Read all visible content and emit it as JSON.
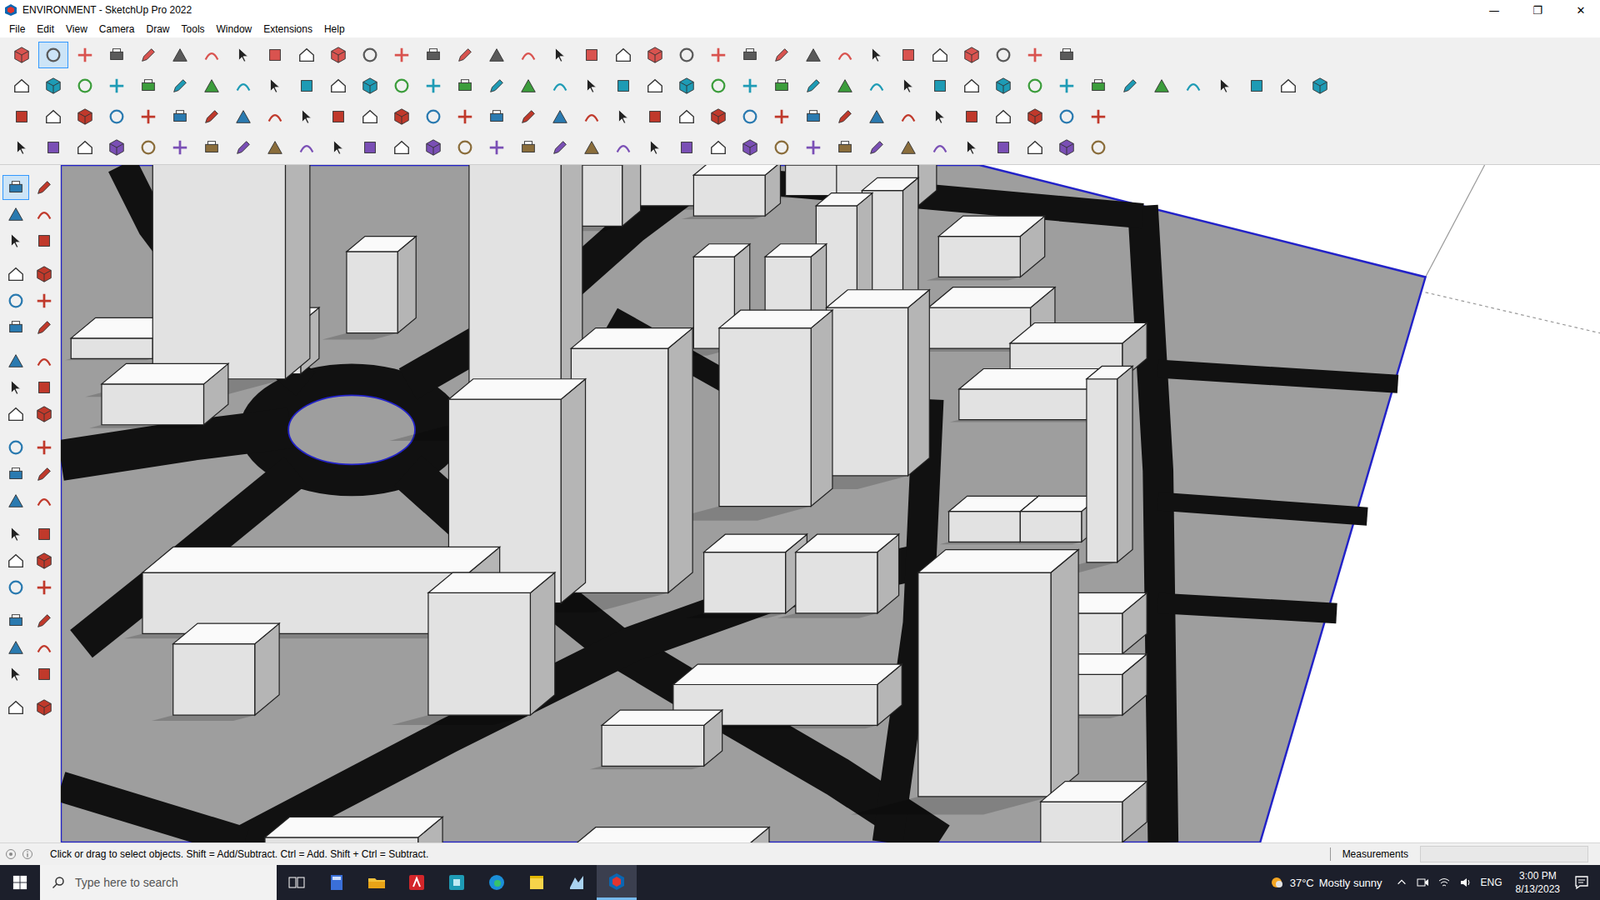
{
  "window": {
    "title": "ENVIRONMENT - SketchUp Pro 2022",
    "controls": [
      "—",
      "❐",
      "✕"
    ]
  },
  "menu": [
    "File",
    "Edit",
    "View",
    "Camera",
    "Draw",
    "Tools",
    "Window",
    "Extensions",
    "Help"
  ],
  "toolbars": [
    {
      "buttons": [
        {
          "selected": false
        },
        {
          "selected": true
        },
        {
          "selected": false
        },
        {
          "selected": false
        },
        {
          "selected": false
        },
        {
          "selected": false
        },
        {
          "selected": false
        },
        {
          "selected": false
        },
        {
          "selected": false
        },
        {
          "selected": false
        },
        {
          "selected": false
        },
        {
          "selected": false
        },
        {
          "selected": false
        },
        {
          "selected": false
        },
        {
          "selected": false
        },
        {
          "selected": false
        },
        {
          "selected": false
        },
        {
          "selected": false
        },
        {
          "selected": false
        },
        {
          "selected": false
        },
        {
          "selected": false
        },
        {
          "selected": false
        },
        {
          "selected": false
        },
        {
          "selected": false
        },
        {
          "selected": false
        },
        {
          "selected": false
        },
        {
          "selected": false
        },
        {
          "selected": false
        },
        {
          "selected": false
        },
        {
          "selected": false
        },
        {
          "selected": false
        },
        {
          "selected": false
        },
        {
          "selected": false
        },
        {
          "selected": false
        }
      ]
    },
    {
      "buttons": [
        {
          "selected": false
        },
        {
          "selected": false
        },
        {
          "selected": false
        },
        {
          "selected": false
        },
        {
          "selected": false
        },
        {
          "selected": false
        },
        {
          "selected": false
        },
        {
          "selected": false
        },
        {
          "selected": false
        },
        {
          "selected": false
        },
        {
          "selected": false
        },
        {
          "selected": false
        },
        {
          "selected": false
        },
        {
          "selected": false
        },
        {
          "selected": false
        },
        {
          "selected": false
        },
        {
          "selected": false
        },
        {
          "selected": false
        },
        {
          "selected": false
        },
        {
          "selected": false
        },
        {
          "selected": false
        },
        {
          "selected": false
        },
        {
          "selected": false
        },
        {
          "selected": false
        },
        {
          "selected": false
        },
        {
          "selected": false
        },
        {
          "selected": false
        },
        {
          "selected": false
        },
        {
          "selected": false
        },
        {
          "selected": false
        },
        {
          "selected": false
        },
        {
          "selected": false
        },
        {
          "selected": false
        },
        {
          "selected": false
        },
        {
          "selected": false
        },
        {
          "selected": false
        },
        {
          "selected": false
        },
        {
          "selected": false
        },
        {
          "selected": false
        },
        {
          "selected": false
        },
        {
          "selected": false
        },
        {
          "selected": false
        }
      ]
    },
    {
      "buttons": [
        {
          "selected": false
        },
        {
          "selected": false
        },
        {
          "selected": false
        },
        {
          "selected": false
        },
        {
          "selected": false
        },
        {
          "selected": false
        },
        {
          "selected": false
        },
        {
          "selected": false
        },
        {
          "selected": false
        },
        {
          "selected": false
        },
        {
          "selected": false
        },
        {
          "selected": false
        },
        {
          "selected": false
        },
        {
          "selected": false
        },
        {
          "selected": false
        },
        {
          "selected": false
        },
        {
          "selected": false
        },
        {
          "selected": false
        },
        {
          "selected": false
        },
        {
          "selected": false
        },
        {
          "selected": false
        },
        {
          "selected": false
        },
        {
          "selected": false
        },
        {
          "selected": false
        },
        {
          "selected": false
        },
        {
          "selected": false
        },
        {
          "selected": false
        },
        {
          "selected": false
        },
        {
          "selected": false
        },
        {
          "selected": false
        },
        {
          "selected": false
        },
        {
          "selected": false
        },
        {
          "selected": false
        },
        {
          "selected": false
        },
        {
          "selected": false
        }
      ]
    },
    {
      "buttons": [
        {
          "selected": false
        },
        {
          "selected": false
        },
        {
          "selected": false
        },
        {
          "selected": false
        },
        {
          "selected": false
        },
        {
          "selected": false
        },
        {
          "selected": false
        },
        {
          "selected": false
        },
        {
          "selected": false
        },
        {
          "selected": false
        },
        {
          "selected": false
        },
        {
          "selected": false
        },
        {
          "selected": false
        },
        {
          "selected": false
        },
        {
          "selected": false
        },
        {
          "selected": false
        },
        {
          "selected": false
        },
        {
          "selected": false
        },
        {
          "selected": false
        },
        {
          "selected": false
        },
        {
          "selected": false
        },
        {
          "selected": false
        },
        {
          "selected": false
        },
        {
          "selected": false
        },
        {
          "selected": false
        },
        {
          "selected": false
        },
        {
          "selected": false
        },
        {
          "selected": false
        },
        {
          "selected": false
        },
        {
          "selected": false
        },
        {
          "selected": false
        },
        {
          "selected": false
        },
        {
          "selected": false
        },
        {
          "selected": false
        },
        {
          "selected": false
        }
      ]
    }
  ],
  "tool_palette": {
    "buttons": [
      {
        "selected": true
      },
      {
        "selected": false
      },
      {
        "selected": false
      },
      {
        "selected": false
      },
      {
        "selected": false
      },
      {
        "selected": false
      },
      {
        "selected": false
      },
      {
        "selected": false
      },
      {
        "selected": false
      },
      {
        "selected": false
      },
      {
        "selected": false
      },
      {
        "selected": false
      },
      {
        "selected": false
      },
      {
        "selected": false
      },
      {
        "selected": false
      },
      {
        "selected": false
      },
      {
        "selected": false
      },
      {
        "selected": false
      },
      {
        "selected": false
      },
      {
        "selected": false
      },
      {
        "selected": false
      },
      {
        "selected": false
      },
      {
        "selected": false
      },
      {
        "selected": false
      },
      {
        "selected": false
      },
      {
        "selected": false
      },
      {
        "selected": false
      },
      {
        "selected": false
      },
      {
        "selected": false
      },
      {
        "selected": false
      },
      {
        "selected": false
      },
      {
        "selected": false
      },
      {
        "selected": false
      },
      {
        "selected": false
      },
      {
        "selected": false
      },
      {
        "selected": false
      },
      {
        "selected": false
      },
      {
        "selected": false
      }
    ]
  },
  "status_bar": {
    "hint": "Click or drag to select objects. Shift = Add/Subtract. Ctrl = Add. Shift + Ctrl = Subtract.",
    "measurements_label": "Measurements"
  },
  "taskbar": {
    "search_placeholder": "Type here to search",
    "apps": [
      {
        "selected": false
      },
      {
        "selected": false
      },
      {
        "selected": false
      },
      {
        "selected": false
      },
      {
        "selected": false
      },
      {
        "selected": false
      },
      {
        "selected": false
      },
      {
        "selected": false
      },
      {
        "selected": true
      }
    ],
    "weather": {
      "temperature": "37°C",
      "condition": "Mostly sunny"
    },
    "language": "ENG",
    "time": "3:00 PM",
    "date": "8/13/2023"
  }
}
